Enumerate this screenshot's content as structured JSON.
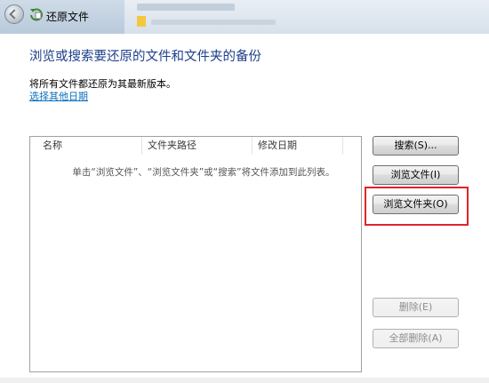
{
  "window": {
    "title": "还原文件"
  },
  "main": {
    "heading": "浏览或搜索要还原的文件和文件夹的备份",
    "description": "将所有文件都还原为其最新版本。",
    "choose_date_link": "选择其他日期"
  },
  "file_list": {
    "columns": [
      "名称",
      "文件夹路径",
      "修改日期"
    ],
    "empty_message": "单击“浏览文件”、“浏览文件夹”或“搜索”将文件添加到此列表。",
    "rows": []
  },
  "buttons": {
    "search": "搜索(S)...",
    "browse_files": "浏览文件(I)",
    "browse_folders": "浏览文件夹(O)",
    "delete": "删除(E)",
    "delete_all": "全部删除(A)"
  },
  "colors": {
    "heading": "#1e3f8a",
    "link": "#0b6fbd",
    "highlight": "#e0242a"
  }
}
